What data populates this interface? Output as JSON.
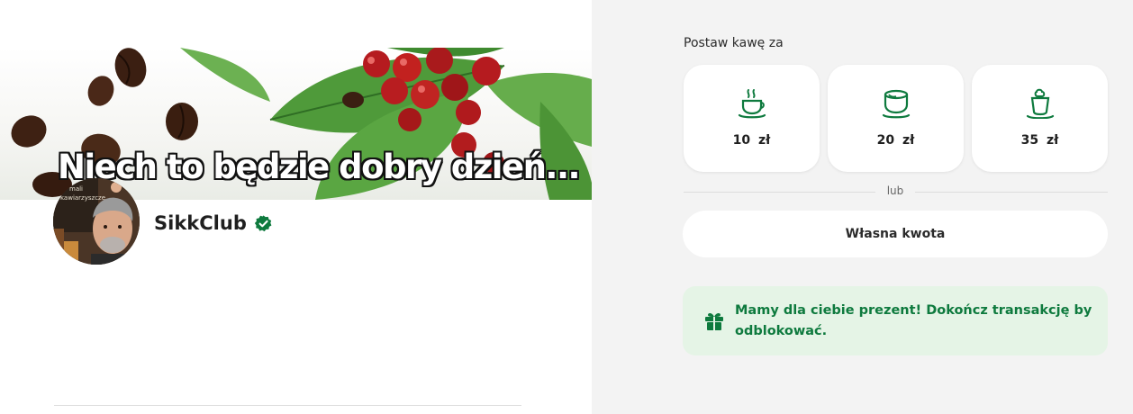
{
  "banner": {
    "caption": "Niech to będzie dobry dzień..."
  },
  "profile": {
    "name": "SikkClub",
    "avatar_text": "Mali kawiarzyści"
  },
  "donate": {
    "prompt": "Postaw kawę za",
    "options": [
      {
        "amount": "10 zł",
        "icon": "hot-coffee-icon"
      },
      {
        "amount": "20 zł",
        "icon": "coffee-cup-icon"
      },
      {
        "amount": "35 zł",
        "icon": "latte-glass-icon"
      }
    ],
    "or_label": "lub",
    "custom_label": "Własna kwota"
  },
  "gift": {
    "icon": "gift-icon",
    "text": "Mamy dla ciebie prezent! Dokończ transakcję by odblokować."
  },
  "colors": {
    "accent": "#0e7a3e",
    "gift_bg": "#e5f4e6",
    "right_bg": "#f3f3f3"
  }
}
